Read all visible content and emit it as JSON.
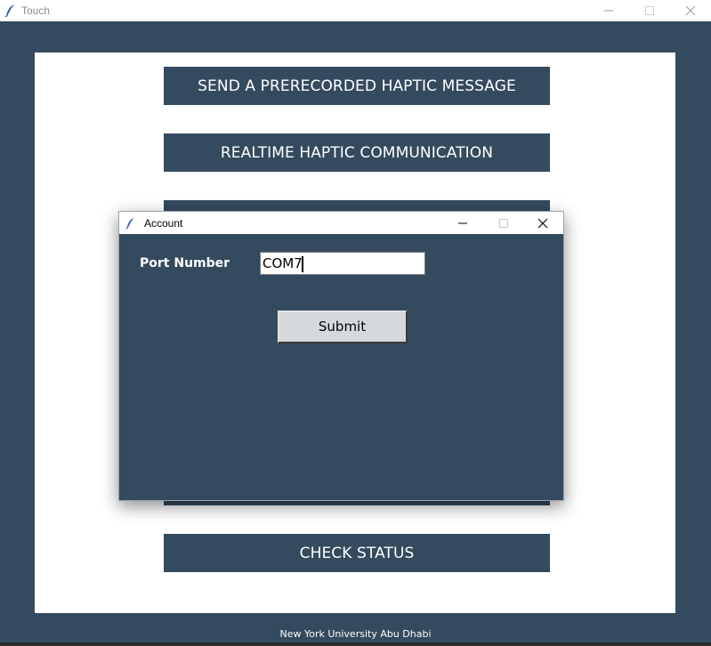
{
  "window": {
    "title": "Touch",
    "controls": {
      "minimize_icon": "minimize-icon",
      "maximize_icon": "maximize-icon",
      "close_icon": "close-icon"
    }
  },
  "menu": {
    "buttons": [
      {
        "label": "SEND A PRERECORDED HAPTIC MESSAGE"
      },
      {
        "label": "REALTIME HAPTIC COMMUNICATION"
      },
      {
        "label": ""
      },
      {
        "label": ""
      },
      {
        "label": "CHECK STATUS"
      }
    ]
  },
  "footer": {
    "text": "New York University Abu Dhabi"
  },
  "dialog": {
    "title": "Account",
    "port_label": "Port Number",
    "port_value": "COM7",
    "submit_label": "Submit"
  },
  "colors": {
    "background": "#344a5e",
    "panel": "#ffffff",
    "button_bg": "#344a5e",
    "submit_bg": "#d6d9dc"
  }
}
